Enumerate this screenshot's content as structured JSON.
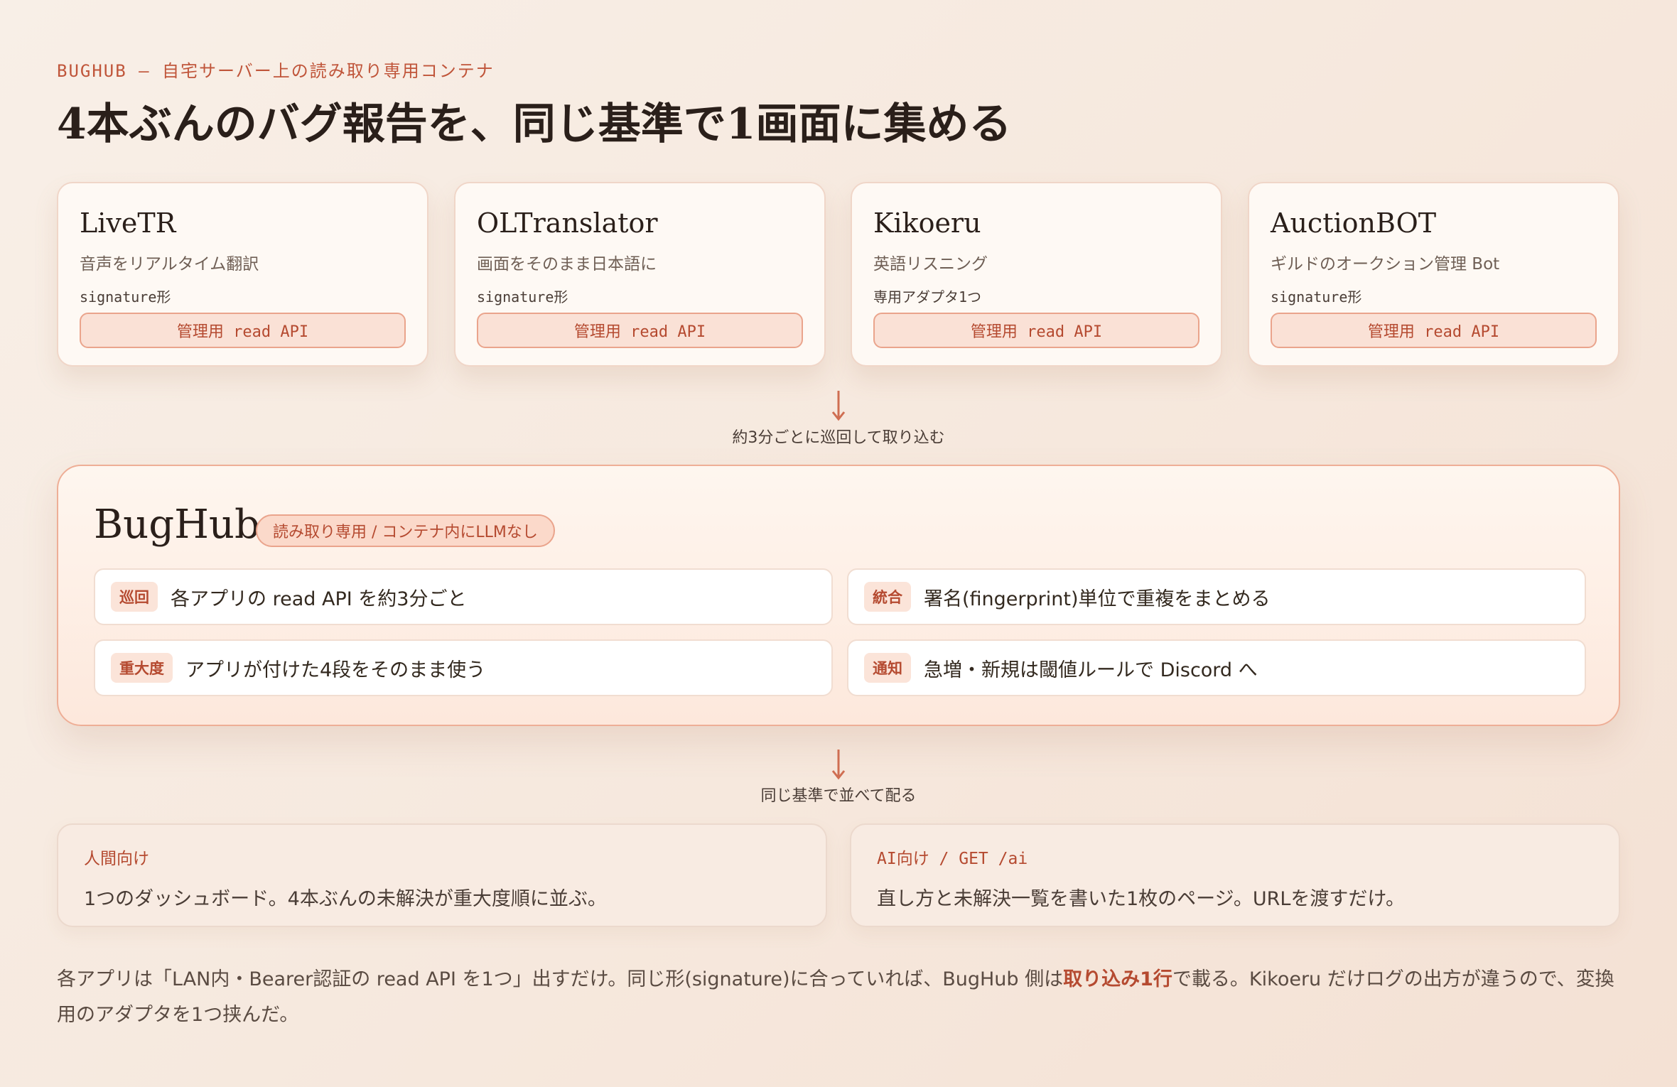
{
  "eyebrow": "BUGHUB — 自宅サーバー上の読み取り専用コンテナ",
  "headline": "4本ぶんのバグ報告を、同じ基準で1画面に集める",
  "apps": [
    {
      "name": "LiveTR",
      "desc": "音声をリアルタイム翻訳",
      "tag": "signature形",
      "api": "管理用 read API"
    },
    {
      "name": "OLTranslator",
      "desc": "画面をそのまま日本語に",
      "tag": "signature形",
      "api": "管理用 read API"
    },
    {
      "name": "Kikoeru",
      "desc": "英語リスニング",
      "tag": "専用アダプタ1つ",
      "api": "管理用 read API"
    },
    {
      "name": "AuctionBOT",
      "desc": "ギルドのオークション管理 Bot",
      "tag": "signature形",
      "api": "管理用 read API"
    }
  ],
  "flow1_label": "約3分ごとに巡回して取り込む",
  "hub": {
    "title": "BugHub",
    "badge": "読み取り専用 / コンテナ内にLLMなし",
    "features": [
      {
        "tag": "巡回",
        "text": "各アプリの read API を約3分ごと"
      },
      {
        "tag": "統合",
        "text": "署名(fingerprint)単位で重複をまとめる"
      },
      {
        "tag": "重大度",
        "text": "アプリが付けた4段をそのまま使う"
      },
      {
        "tag": "通知",
        "text": "急増・新規は閾値ルールで Discord へ"
      }
    ]
  },
  "flow2_label": "同じ基準で並べて配る",
  "outputs": [
    {
      "label": "人間向け",
      "text": "1つのダッシュボード。4本ぶんの未解決が重大度順に並ぶ。"
    },
    {
      "label": "AI向け / GET /ai",
      "text": "直し方と未解決一覧を書いた1枚のページ。URLを渡すだけ。"
    }
  ],
  "footnote": {
    "before": "各アプリは「LAN内・Bearer認証の read API を1つ」出すだけ。同じ形(signature)に合っていれば、BugHub 側は",
    "emphasis": "取り込み1行",
    "after": "で載る。Kikoeru だけログの出方が違うので、変換用のアダプタを1つ挟んだ。"
  },
  "colors": {
    "accent": "#c0553a",
    "arrow": "#cf6e52"
  }
}
